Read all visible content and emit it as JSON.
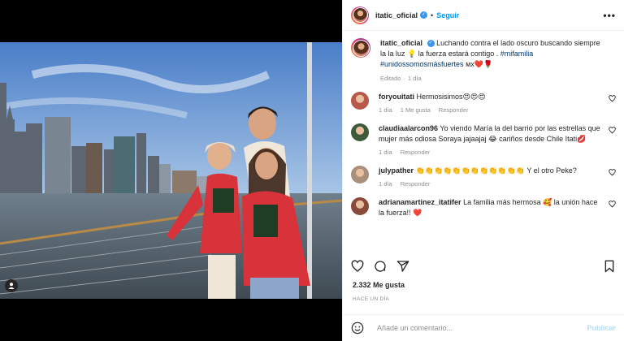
{
  "header": {
    "username": "itatic_oficial",
    "separator": "•",
    "follow_label": "Seguir",
    "more_label": "•••"
  },
  "caption": {
    "username": "itatic_oficial",
    "text": "Luchando contra el lado oscuro buscando siempre la la luz 💡 la fuerza estará contigo . ",
    "hashtags": "#mifamilia #unidossomosmásfuertes",
    "suffix": " ᴍx❤️🌹",
    "edited": "Editado",
    "time": "1 día"
  },
  "comments": [
    {
      "username": "foryouitati",
      "text": "Hermosisimos😍😍😍",
      "time": "1 día",
      "likes": "1 Me gusta",
      "reply": "Responder",
      "avatar_color": "#b85a4a"
    },
    {
      "username": "claudiaalarcon96",
      "text": "Yo viendo María la del barrio por las estrellas que mujer más odiosa Soraya jajaajaj 😂 cariños desde Chile Itati💋",
      "time": "1 día",
      "likes": "",
      "reply": "Responder",
      "avatar_color": "#3d5a3a"
    },
    {
      "username": "julypather",
      "text": "👏👏👏👏👏👏👏👏👏👏👏👏 Y el otro Peke?",
      "time": "1 día",
      "likes": "",
      "reply": "Responder",
      "avatar_color": "#a98f7c"
    },
    {
      "username": "adrianamartinez_itatifer",
      "text": "La familia más hermosa 🥰 la unión hace la fuerza!! ❤️",
      "time": "",
      "likes": "",
      "reply": "",
      "avatar_color": "#8a4a3a"
    }
  ],
  "actions": {
    "like_icon": "heart-icon",
    "comment_icon": "comment-icon",
    "share_icon": "paper-plane-icon",
    "save_icon": "bookmark-icon"
  },
  "likes_text": "2.332 Me gusta",
  "date_text": "HACE UN DÍA",
  "add_comment": {
    "placeholder": "Añade un comentario...",
    "publish_label": "Publicar"
  },
  "colors": {
    "accent": "#0095f6",
    "publish_disabled": "#b2dffc",
    "secondary_text": "#8e8e8e",
    "hashtag": "#00376b"
  }
}
